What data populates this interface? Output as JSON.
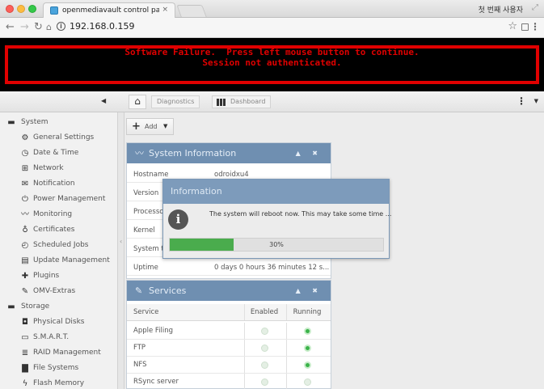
{
  "browser": {
    "tab_title": "openmediavault control pane",
    "tab_close": "×",
    "profile_label": "첫 번째 사용자",
    "url": "192.168.0.159",
    "icons": [
      "back-icon",
      "forward-icon",
      "reload-icon",
      "home-icon",
      "info-icon",
      "star-icon",
      "extension-icon",
      "menu-icon"
    ]
  },
  "failure": {
    "line1": "Software Failure.  Press left mouse button to continue.",
    "line2": "Session not authenticated.",
    "color": "#e00000"
  },
  "omv_toolbar": {
    "crumb_diagnostics": "Diagnostics",
    "crumb_dashboard": "Dashboard"
  },
  "sidebar": {
    "items": [
      {
        "label": "System",
        "icon": "minus-box-icon",
        "level": "group"
      },
      {
        "label": "General Settings",
        "icon": "gears-icon",
        "level": "child"
      },
      {
        "label": "Date & Time",
        "icon": "clock-icon",
        "level": "child"
      },
      {
        "label": "Network",
        "icon": "network-icon",
        "level": "child"
      },
      {
        "label": "Notification",
        "icon": "mail-icon",
        "level": "child"
      },
      {
        "label": "Power Management",
        "icon": "power-icon",
        "level": "child"
      },
      {
        "label": "Monitoring",
        "icon": "monitoring-icon",
        "level": "child"
      },
      {
        "label": "Certificates",
        "icon": "certificate-icon",
        "level": "child"
      },
      {
        "label": "Scheduled Jobs",
        "icon": "clock-gear-icon",
        "level": "child"
      },
      {
        "label": "Update Management",
        "icon": "trash-update-icon",
        "level": "child"
      },
      {
        "label": "Plugins",
        "icon": "puzzle-icon",
        "level": "child"
      },
      {
        "label": "OMV-Extras",
        "icon": "wrench-icon",
        "level": "child"
      },
      {
        "label": "Storage",
        "icon": "minus-box-icon",
        "level": "group"
      },
      {
        "label": "Physical Disks",
        "icon": "disk-icon",
        "level": "child"
      },
      {
        "label": "S.M.A.R.T.",
        "icon": "smart-icon",
        "level": "child"
      },
      {
        "label": "RAID Management",
        "icon": "raid-icon",
        "level": "child"
      },
      {
        "label": "File Systems",
        "icon": "folder-icon",
        "level": "child"
      },
      {
        "label": "Flash Memory",
        "icon": "flash-icon",
        "level": "child"
      }
    ]
  },
  "main": {
    "add_label": "Add",
    "system_info": {
      "title": "System Information",
      "rows": [
        {
          "key": "Hostname",
          "value": "odroidxu4"
        },
        {
          "key": "Version",
          "value": ""
        },
        {
          "key": "Processo",
          "value": ""
        },
        {
          "key": "Kernel",
          "value": ""
        },
        {
          "key": "System ti",
          "value": ""
        },
        {
          "key": "Uptime",
          "value": "0 days 0 hours 36 minutes 12 s..."
        }
      ]
    },
    "services": {
      "title": "Services",
      "headers": {
        "service": "Service",
        "enabled": "Enabled",
        "running": "Running"
      },
      "rows": [
        {
          "name": "Apple Filing",
          "enabled": false,
          "running": true
        },
        {
          "name": "FTP",
          "enabled": false,
          "running": true
        },
        {
          "name": "NFS",
          "enabled": false,
          "running": true
        },
        {
          "name": "RSync server",
          "enabled": false,
          "running": false
        }
      ]
    }
  },
  "dialog": {
    "title": "Information",
    "message": "The system will reboot now. This may take some time ...",
    "progress_fraction": 0.3,
    "progress_text": "30%",
    "progress_color": "#4aac4d"
  }
}
